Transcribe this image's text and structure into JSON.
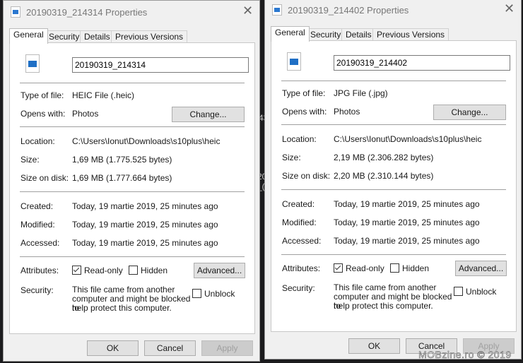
{
  "background_fragments": [
    "43",
    "20",
    "_("
  ],
  "dialogs": [
    {
      "title": "20190319_214314 Properties",
      "tabs": [
        "General",
        "Security",
        "Details",
        "Previous Versions"
      ],
      "filename": "20190319_214314",
      "type_label": "Type of file:",
      "type_value": "HEIC File (.heic)",
      "opens_label": "Opens with:",
      "opens_value": "Photos",
      "change_button": "Change...",
      "location_label": "Location:",
      "location_value": "C:\\Users\\Ionut\\Downloads\\s10plus\\heic",
      "size_label": "Size:",
      "size_value": "1,69 MB (1.775.525 bytes)",
      "disk_label": "Size on disk:",
      "disk_value": "1,69 MB (1.777.664 bytes)",
      "created_label": "Created:",
      "created_value": "Today, 19 martie 2019, 25 minutes ago",
      "modified_label": "Modified:",
      "modified_value": "Today, 19 martie 2019, 25 minutes ago",
      "accessed_label": "Accessed:",
      "accessed_value": "Today, 19 martie 2019, 25 minutes ago",
      "attributes_label": "Attributes:",
      "readonly_label": "Read-only",
      "readonly_checked": true,
      "hidden_label": "Hidden",
      "hidden_checked": false,
      "advanced_button": "Advanced...",
      "security_label": "Security:",
      "security_lines": [
        "This file came from another",
        "computer and might be blocked to",
        "help protect this computer."
      ],
      "unblock_label": "Unblock",
      "unblock_checked": false,
      "ok": "OK",
      "cancel": "Cancel",
      "apply": "Apply"
    },
    {
      "title": "20190319_214402 Properties",
      "tabs": [
        "General",
        "Security",
        "Details",
        "Previous Versions"
      ],
      "filename": "20190319_214402",
      "type_label": "Type of file:",
      "type_value": "JPG File (.jpg)",
      "opens_label": "Opens with:",
      "opens_value": "Photos",
      "change_button": "Change...",
      "location_label": "Location:",
      "location_value": "C:\\Users\\Ionut\\Downloads\\s10plus\\heic",
      "size_label": "Size:",
      "size_value": "2,19 MB (2.306.282 bytes)",
      "disk_label": "Size on disk:",
      "disk_value": "2,20 MB (2.310.144 bytes)",
      "created_label": "Created:",
      "created_value": "Today, 19 martie 2019, 25 minutes ago",
      "modified_label": "Modified:",
      "modified_value": "Today, 19 martie 2019, 25 minutes ago",
      "accessed_label": "Accessed:",
      "accessed_value": "Today, 19 martie 2019, 25 minutes ago",
      "attributes_label": "Attributes:",
      "readonly_label": "Read-only",
      "readonly_checked": true,
      "hidden_label": "Hidden",
      "hidden_checked": false,
      "advanced_button": "Advanced...",
      "security_label": "Security:",
      "security_lines": [
        "This file came from another",
        "computer and might be blocked to",
        "help protect this computer."
      ],
      "unblock_label": "Unblock",
      "unblock_checked": false,
      "ok": "OK",
      "cancel": "Cancel",
      "apply": "Apply"
    }
  ],
  "watermark": "MOBzine.ro © 2019"
}
